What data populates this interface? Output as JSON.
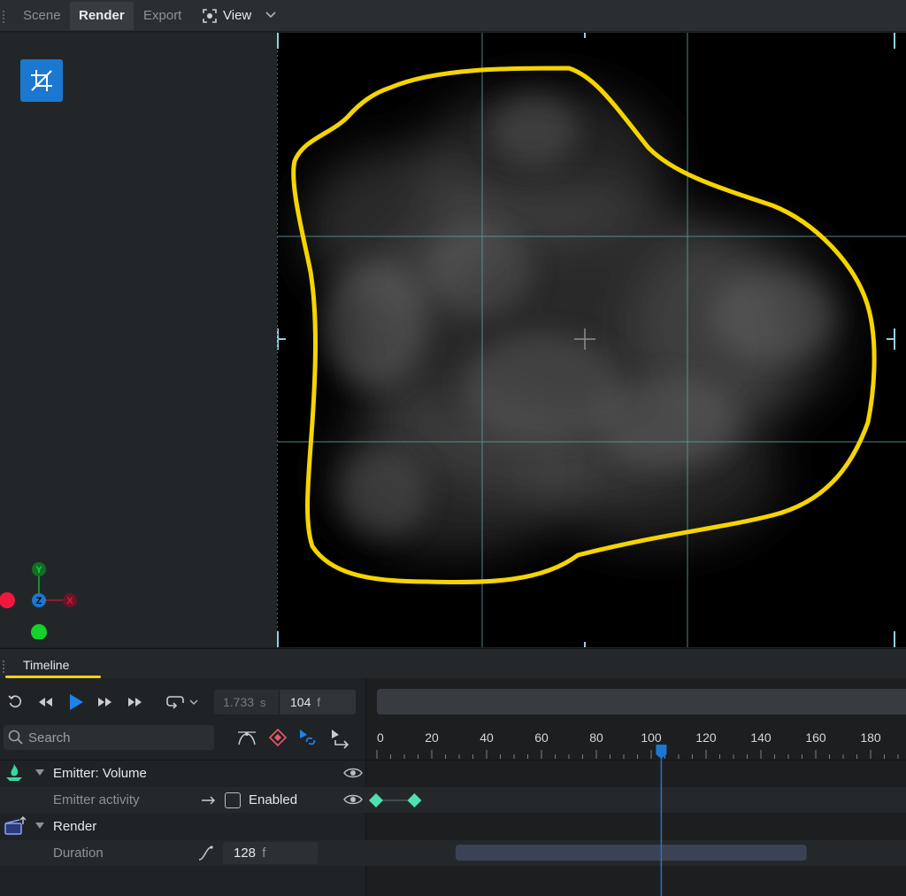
{
  "tabs": [
    {
      "label": "Scene",
      "active": false
    },
    {
      "label": "Render",
      "active": true
    },
    {
      "label": "Export",
      "active": false
    }
  ],
  "view_menu": {
    "label": "View",
    "icon": "view-focus-icon"
  },
  "left_tool": {
    "icon": "crop-off-icon",
    "accent": "#1b78d1"
  },
  "axis_gizmo": {
    "y": "Y",
    "z": "Z",
    "x": "X"
  },
  "timeline": {
    "tab_label": "Timeline",
    "time_seconds": "1.733",
    "time_seconds_unit": "s",
    "time_frames": "104",
    "time_frames_unit": "f",
    "search_placeholder": "Search",
    "ruler_ticks": [
      "0",
      "20",
      "40",
      "60",
      "80",
      "100",
      "120",
      "140",
      "160",
      "180"
    ],
    "current_frame": 104,
    "rows": {
      "emitter_title": "Emitter: Volume",
      "emitter_activity": "Emitter activity",
      "enabled_label": "Enabled",
      "render_title": "Render",
      "duration_label": "Duration",
      "duration_value": "128",
      "duration_unit": "f"
    },
    "keyframes": [
      0,
      14
    ],
    "duration_bar": {
      "start": 29,
      "end": 157
    }
  },
  "colors": {
    "accent": "#1b78d1",
    "highlight": "#f5d400",
    "keyframe": "#4fe0b0",
    "grid": "#5f9aa3"
  }
}
